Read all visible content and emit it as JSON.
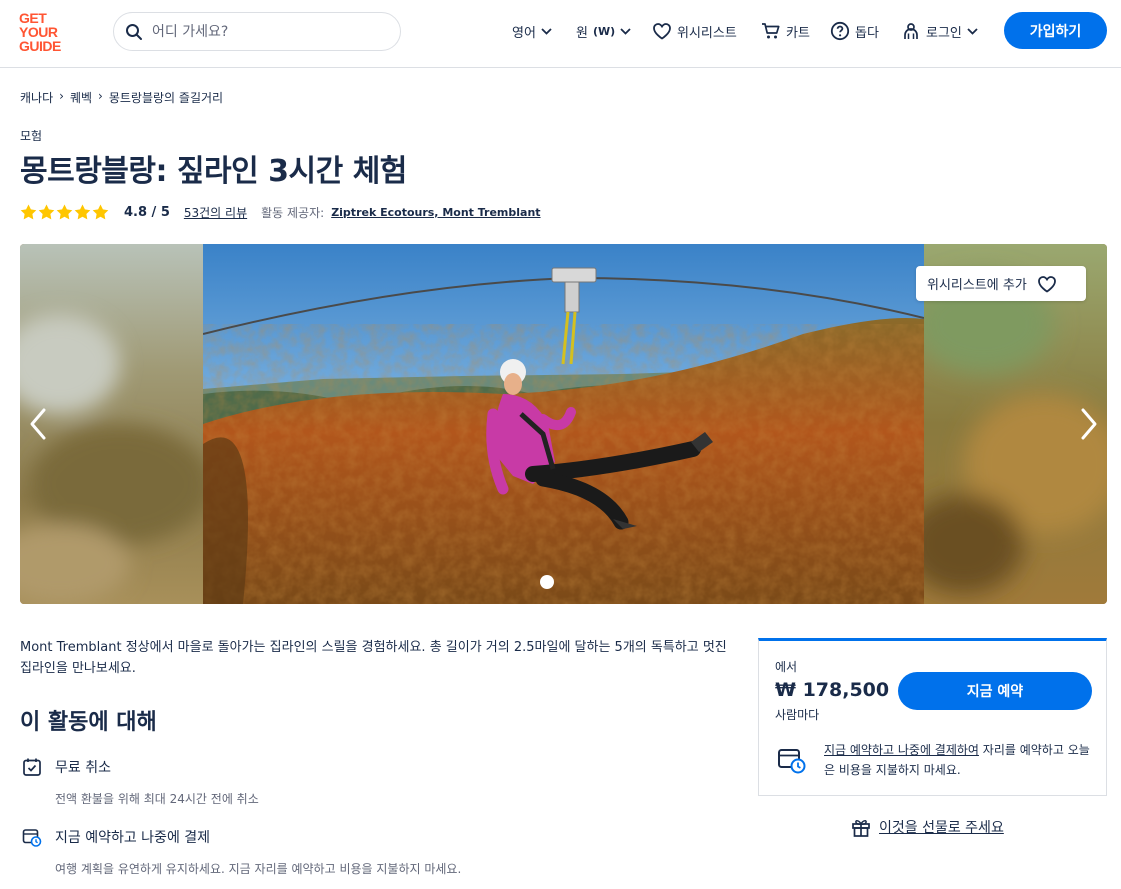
{
  "brand": {
    "logo_lines": [
      "GET",
      "YOUR",
      "GUIDE"
    ],
    "color": "#ff5533"
  },
  "header": {
    "search_placeholder": "어디 가세요?",
    "language": "영어",
    "currency_label": "원",
    "currency_code": "(W)",
    "wishlist": "위시리스트",
    "cart": "카트",
    "help": "돕다",
    "login": "로그인",
    "signup": "가입하기"
  },
  "breadcrumb": [
    "캐나다",
    "퀘벡",
    "몽트랑블랑의 즐길거리"
  ],
  "product": {
    "category": "모험",
    "title": "몽트랑블랑: 짚라인 3시간 체험",
    "rating_stars": 5,
    "rating": "4.8 / 5",
    "reviews": "53건의 리뷰",
    "provider_label": "활동 제공자:",
    "provider": "Ziptrek Ecotours, Mont Tremblant"
  },
  "gallery": {
    "wishlist_button": "위시리스트에 추가",
    "current_slide": 1
  },
  "description": "Mont Tremblant 정상에서 마을로 돌아가는 집라인의 스릴을 경험하세요. 총 길이가 거의 2.5마일에 달하는 5개의 독특하고 멋진 집라인을 만나보세요.",
  "about": {
    "title": "이 활동에 대해",
    "features": [
      {
        "icon": "calendar-check-icon",
        "title": "무료 취소",
        "desc": "전액 환불을 위해 최대 24시간 전에 취소"
      },
      {
        "icon": "calendar-clock-icon",
        "title": "지금 예약하고 나중에 결제",
        "desc": "여행 계획을 유연하게 유지하세요. 지금 자리를 예약하고 비용을 지불하지 마세요."
      }
    ]
  },
  "booking": {
    "from": "에서",
    "price": "₩ 178,500",
    "per": "사람마다",
    "book_button": "지금 예약",
    "rnpl_link": "지금 예약하고 나중에 결제하여",
    "rnpl_rest": " 자리를 예약하고 오늘은 비용을 지불하지 마세요.",
    "gift": "이것을 선물로 주세요"
  },
  "colors": {
    "accent": "#0071eb",
    "text": "#1a2b49",
    "star": "#ffc600"
  }
}
